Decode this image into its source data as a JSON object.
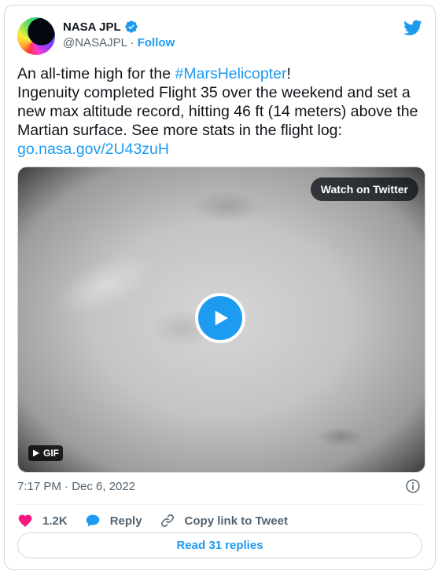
{
  "author": {
    "name": "NASA JPL",
    "handle": "@NASAJPL",
    "separator": " · ",
    "follow_label": "Follow"
  },
  "tweet": {
    "line1_prefix": "An all-time high for the ",
    "line1_hashtag": "#MarsHelicopter",
    "line1_suffix": "!",
    "body": "Ingenuity completed Flight 35 over the weekend and set a new max altitude record, hitting 46 ft (14 meters) above the Martian surface. See more stats in the flight log:",
    "link": "go.nasa.gov/2U43zuH"
  },
  "media": {
    "watch_label": "Watch on Twitter",
    "badge_label": "GIF"
  },
  "meta": {
    "timestamp": "7:17 PM · Dec 6, 2022"
  },
  "actions": {
    "likes": "1.2K",
    "reply_label": "Reply",
    "copy_label": "Copy link to Tweet"
  },
  "replies_button": "Read 31 replies",
  "colors": {
    "accent": "#1d9bf0",
    "like": "#f91880",
    "text": "#0f1419",
    "muted": "#536471",
    "border": "#cfd9de"
  },
  "icons": {
    "verified": "verified-badge-icon",
    "brand": "twitter-bird-icon",
    "play": "play-icon",
    "info": "info-icon",
    "like": "heart-icon",
    "reply": "speech-bubble-icon",
    "copy": "link-icon"
  }
}
